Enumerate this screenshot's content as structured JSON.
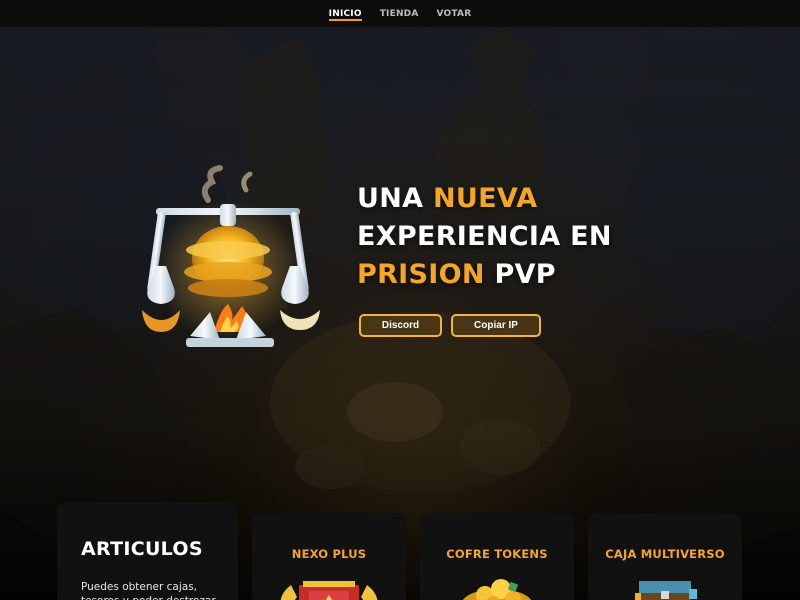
{
  "nav": {
    "items": [
      {
        "label": "INICIO",
        "active": true
      },
      {
        "label": "TIENDA",
        "active": false
      },
      {
        "label": "VOTAR",
        "active": false
      }
    ]
  },
  "hero": {
    "line1_prefix": "UNA ",
    "line1_accent": "NUEVA",
    "line2": "EXPERIENCIA EN",
    "line3_accent": "PRISION",
    "line3_suffix": " PVP",
    "buttons": {
      "discord": "Discord",
      "copy_ip": "Copiar IP"
    },
    "accent_color": "#f5a623"
  },
  "cards": {
    "articulos": {
      "title": "ARTICULOS",
      "description": "Puedes obtener cajas, tesoros y poder destrozar"
    },
    "items": [
      {
        "title": "NEXO PLUS",
        "icon": "banner-crest-icon"
      },
      {
        "title": "COFRE TOKENS",
        "icon": "gold-coins-icon"
      },
      {
        "title": "CAJA MULTIVERSO",
        "icon": "chest-icon"
      }
    ]
  }
}
